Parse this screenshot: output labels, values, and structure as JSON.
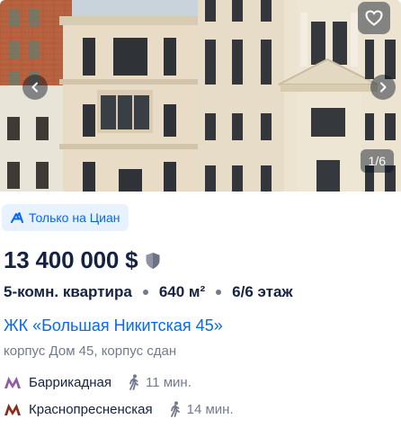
{
  "gallery": {
    "counter": "1/6",
    "favorite_icon": "heart-outline-icon",
    "prev_icon": "chevron-left-icon",
    "next_icon": "chevron-right-icon"
  },
  "badge": {
    "label": "Только на Циан",
    "icon": "cian-logo-icon",
    "color": "#0468ff",
    "background": "#e8f1fe"
  },
  "price": {
    "value": "13 400 000 $",
    "verified_icon": "shield-icon"
  },
  "params": {
    "rooms": "5-комн. квартира",
    "area": "640 м²",
    "floor": "6/6 этаж"
  },
  "complex": {
    "name": "ЖК «Большая Никитская 45»",
    "building": "корпус Дом 45, корпус сдан"
  },
  "metro": [
    {
      "station": "Баррикадная",
      "line_color": "#915aa3",
      "walk_time": "11 мин."
    },
    {
      "station": "Краснопресненская",
      "line_color": "#8b2b1d",
      "walk_time": "14 мин."
    }
  ],
  "colors": {
    "text_primary": "#152242",
    "text_secondary": "#737a8e",
    "link": "#0468ff"
  }
}
